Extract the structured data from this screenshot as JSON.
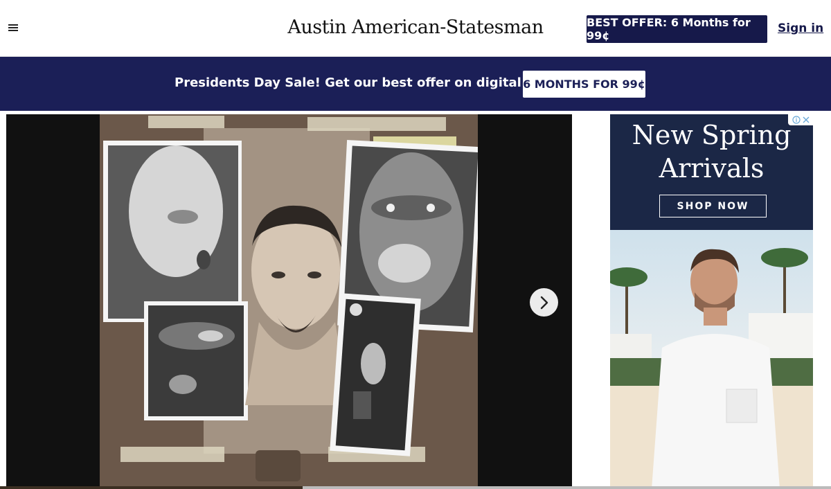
{
  "header": {
    "logo_text": "Austin American-Statesman",
    "offer_label": "BEST OFFER: 6 Months for 99¢",
    "signin_label": "Sign in"
  },
  "promo": {
    "text": "Presidents Day Sale! Get our best offer on digital access.",
    "button_label": "6 MONTHS FOR 99¢"
  },
  "gallery": {
    "next_icon": "chevron-right-icon"
  },
  "ad": {
    "headline_line1": "New Spring",
    "headline_line2": "Arrivals",
    "cta_label": "SHOP NOW",
    "choices_icon": "ad-choices-icon"
  },
  "colors": {
    "brand_navy": "#16194a",
    "promo_navy": "#1b1f57",
    "ad_navy": "#1b2746"
  }
}
